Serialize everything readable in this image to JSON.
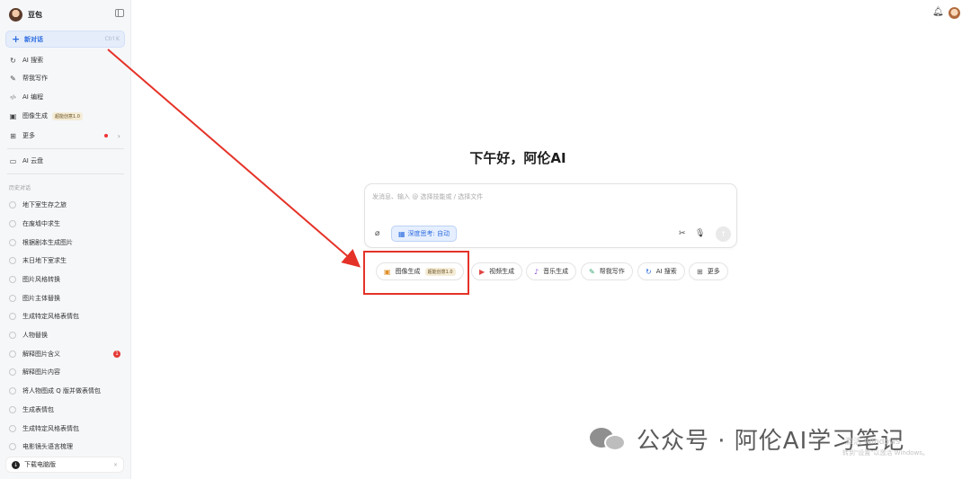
{
  "sidebar": {
    "title": "豆包",
    "new_chat": {
      "label": "新对话",
      "shortcut": "Ctrl K"
    },
    "nav": [
      {
        "label": "AI 搜索",
        "icon": "search-icon",
        "glyph": "↻"
      },
      {
        "label": "帮我写作",
        "icon": "pen-icon",
        "glyph": "✎"
      },
      {
        "label": "AI 编程",
        "icon": "code-icon",
        "glyph": "‹/›"
      },
      {
        "label": "图像生成",
        "icon": "image-icon",
        "glyph": "▣",
        "badge": "超能创意1.0"
      },
      {
        "label": "更多",
        "icon": "grid-icon",
        "glyph": "⊞"
      }
    ],
    "cloud": {
      "label": "AI 云盘",
      "glyph": "▭"
    },
    "history_heading": "历史对话",
    "history": [
      "地下室生存之旅",
      "在废墟中求生",
      "根据剧本生成图片",
      "末日地下室求生",
      "图片风格转换",
      "图片主体替换",
      "生成特定风格表情包",
      "人物替换",
      "解释图片含义",
      "解释图片内容",
      "将人物图成 Q 版并做表情包",
      "生成表情包",
      "生成特定风格表情包",
      "电影镜头语言梳理"
    ],
    "unread_count": "1",
    "download": {
      "label": "下载电脑版",
      "close": "×"
    }
  },
  "main": {
    "greeting": "下午好，阿伦AI",
    "input": {
      "placeholder": "发消息、输入 @ 选择技能或 / 选择文件",
      "deep_think": "深度思考: 自动"
    },
    "pills": [
      {
        "label": "图像生成",
        "glyph": "▣",
        "color": "#e0902a",
        "badge": "超能创意1.0"
      },
      {
        "label": "视频生成",
        "glyph": "▶",
        "color": "#e04545"
      },
      {
        "label": "音乐生成",
        "glyph": "♪",
        "color": "#8a4fd6"
      },
      {
        "label": "帮我写作",
        "glyph": "✎",
        "color": "#2fa36b"
      },
      {
        "label": "AI 搜索",
        "glyph": "↻",
        "color": "#2d6cdf"
      },
      {
        "label": "更多",
        "glyph": "⊞",
        "color": "#555555"
      }
    ]
  },
  "watermark": {
    "text": "公众号 · 阿伦AI学习笔记",
    "win_line1": "激活 Windows",
    "win_line2": "转到\"设置\"以激活 Windows。"
  },
  "colors": {
    "accent": "#2d6cdf",
    "highlight": "#e53228"
  }
}
